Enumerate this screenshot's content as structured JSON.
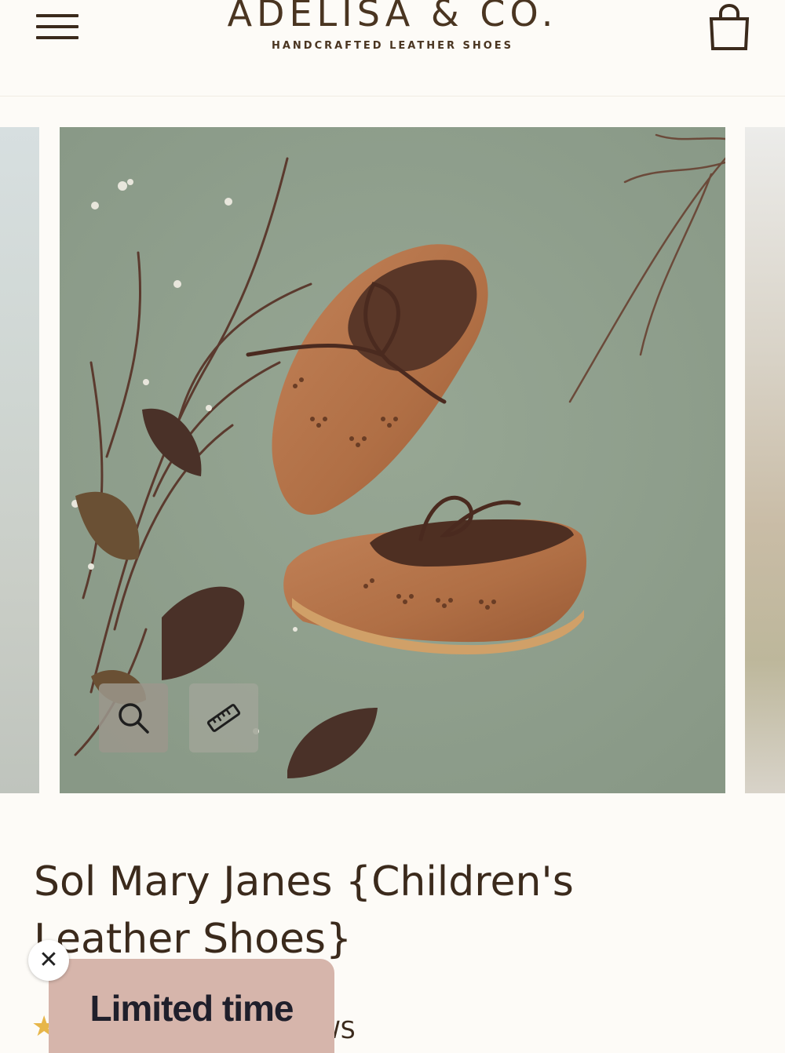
{
  "header": {
    "brand_name": "ADELISA & CO.",
    "brand_tagline": "HANDCRAFTED LEATHER SHOES",
    "menu_icon": "hamburger-menu-icon",
    "cart_icon": "shopping-bag-icon"
  },
  "gallery": {
    "main_image_alt": "Brown leather mary jane shoes with laces on sage green background with dried branches and leaves",
    "zoom_icon": "magnifier-icon",
    "size_guide_icon": "ruler-icon"
  },
  "product": {
    "title": "Sol Mary Janes {Children's Leather Shoes}",
    "reviews_partial": "WS"
  },
  "promo": {
    "label": "Limited time",
    "close_symbol": "✕"
  },
  "colors": {
    "background": "#fdfbf7",
    "text": "#3b2a1c",
    "photo_background": "#8f9f8c",
    "promo_background": "#d6b5ab",
    "star": "#e7b64a"
  }
}
